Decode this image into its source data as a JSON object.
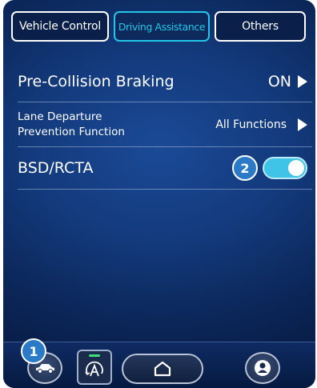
{
  "tabs": [
    {
      "label": "Vehicle Control",
      "selected": false
    },
    {
      "label": "Driving Assistance",
      "selected": true
    },
    {
      "label": "Others",
      "selected": false
    }
  ],
  "settings": [
    {
      "label": "Pre-Collision Braking",
      "value": "ON"
    },
    {
      "label_line1": "Lane Departure",
      "label_line2": "Prevention Function",
      "value": "All Functions"
    },
    {
      "label": "BSD/RCTA",
      "toggle_on": true
    }
  ],
  "callouts": {
    "one": "1",
    "two": "2"
  },
  "colors": {
    "accent": "#23c6e8",
    "toggle": "#3fc3e6",
    "callout": "#2a7ac7",
    "indicator": "#3ee07a"
  },
  "bottom_bar": {
    "icons": [
      "car-icon",
      "auto-mode-icon",
      "home-icon",
      "user-icon"
    ]
  }
}
